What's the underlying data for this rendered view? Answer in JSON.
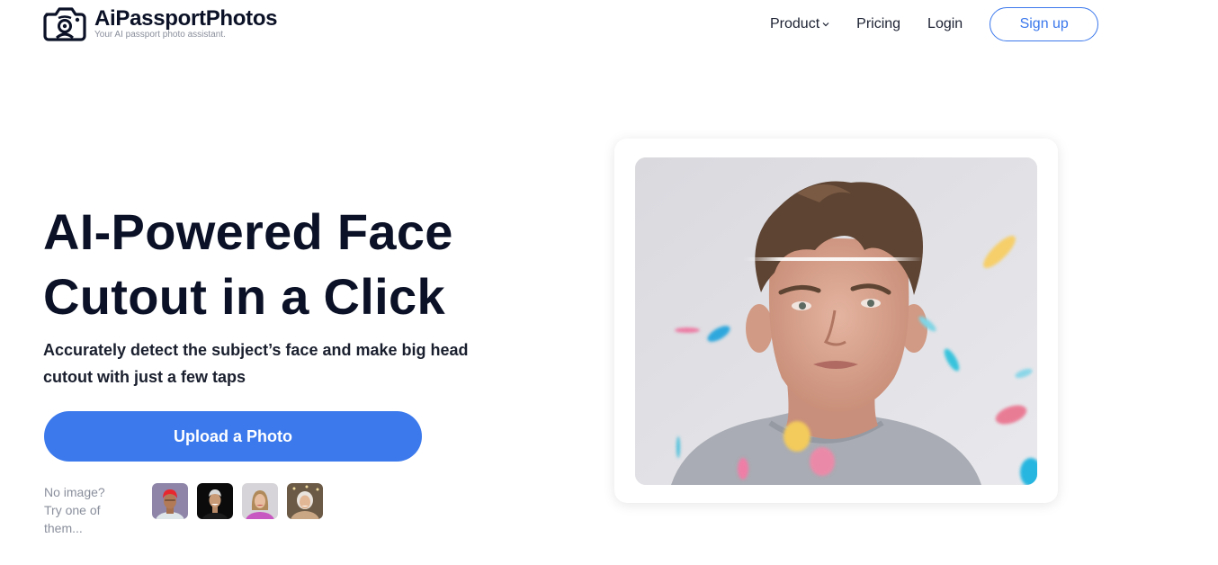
{
  "header": {
    "brand": "AiPassportPhotos",
    "tagline": "Your AI passport photo assistant.",
    "logo_icon": "camera-icon",
    "nav": {
      "product": "Product",
      "pricing": "Pricing",
      "login": "Login",
      "signup": "Sign up"
    }
  },
  "hero": {
    "title_line1": "AI-Powered Face",
    "title_line2": "Cutout in a Click",
    "subtitle": "Accurately detect the subject’s face and make big head cutout with just a few taps",
    "upload_button": "Upload a Photo",
    "sample_label": "No image? Try one of them...",
    "samples": [
      {
        "name": "sample-red-hair-person"
      },
      {
        "name": "sample-man-black-background"
      },
      {
        "name": "sample-woman-pink-top"
      },
      {
        "name": "sample-elderly-woman"
      }
    ],
    "preview_image": "young-man-with-confetti-scan-line"
  },
  "colors": {
    "primary": "#3b79ec",
    "text_dark": "#0b1126",
    "text_muted": "#8a8f9c"
  }
}
